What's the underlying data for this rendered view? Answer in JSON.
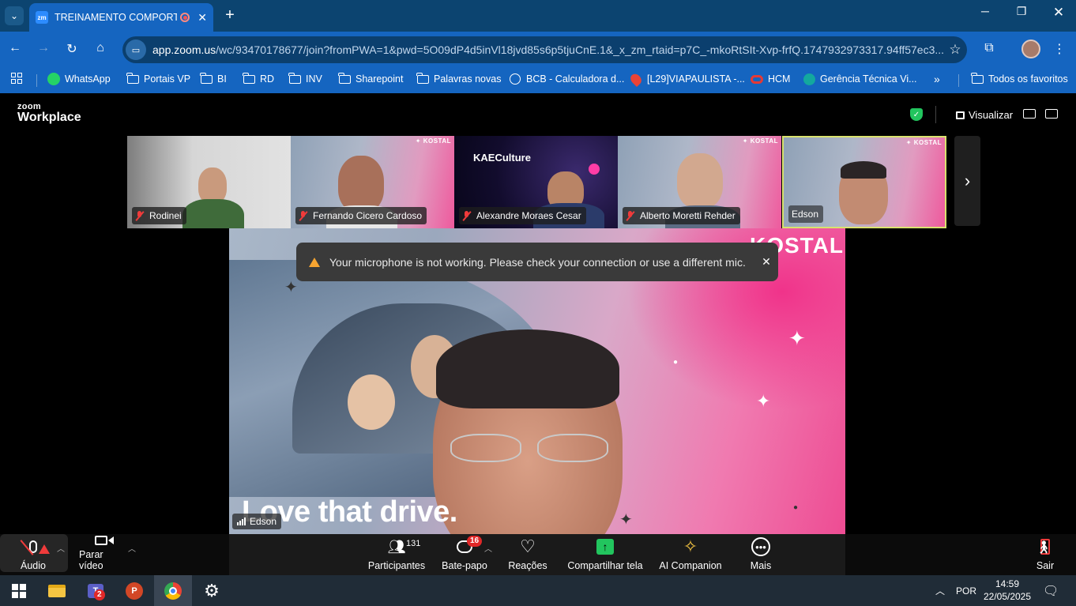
{
  "browser": {
    "tab_title": "TREINAMENTO COMPORTA",
    "tab_favicon": "zm",
    "url_host": "app.zoom.us",
    "url_path": "/wc/93470178677/join?fromPWA=1&pwd=5O09dP4d5inVl18jvd85s6p5tjuCnE.1&_x_zm_rtaid=p7C_-mkoRtSIt-Xvp-frfQ.1747932973317.94ff57ec3...",
    "bookmarks": [
      {
        "label": "WhatsApp",
        "icon": "whatsapp-icon"
      },
      {
        "label": "Portais VP",
        "icon": "folder-icon"
      },
      {
        "label": "BI",
        "icon": "folder-icon"
      },
      {
        "label": "RD",
        "icon": "folder-icon"
      },
      {
        "label": "INV",
        "icon": "folder-icon"
      },
      {
        "label": "Sharepoint",
        "icon": "folder-icon"
      },
      {
        "label": "Palavras novas",
        "icon": "folder-icon"
      },
      {
        "label": "BCB - Calculadora d...",
        "icon": "globe-icon"
      },
      {
        "label": "[L29]VIAPAULISTA -...",
        "icon": "map-pin-icon"
      },
      {
        "label": "HCM",
        "icon": "oracle-icon"
      },
      {
        "label": "Gerência Técnica Vi...",
        "icon": "sharepoint-icon"
      },
      {
        "label": "Todos os favoritos",
        "icon": "folder-icon"
      }
    ]
  },
  "zoom": {
    "logo_top": "zoom",
    "logo_bottom": "Workplace",
    "view_label": "Visualizar",
    "participants_strip": [
      {
        "name": "Rodinei",
        "muted": true
      },
      {
        "name": "Fernando Cicero Cardoso",
        "muted": true
      },
      {
        "name": "Alexandre Moraes Cesar",
        "muted": true
      },
      {
        "name": "Alberto Moretti Rehder",
        "muted": true
      },
      {
        "name": "Edson",
        "muted": false
      }
    ],
    "brand_tag": "✦ KOSTAL",
    "kae_label": "KAECulture",
    "main_speaker": "Edson",
    "main_brand": "KOSTAL",
    "main_slogan": "Love that drive.",
    "toast_message": "Your microphone is not working. Please check your connection or use a different mic.",
    "controls": {
      "audio": "Áudio",
      "video": "Parar vídeo",
      "participants": "Participantes",
      "participants_count": "131",
      "chat": "Bate-papo",
      "chat_badge": "16",
      "reactions": "Reações",
      "share": "Compartilhar tela",
      "ai": "AI Companion",
      "more": "Mais",
      "leave": "Sair"
    }
  },
  "taskbar": {
    "language": "POR",
    "time": "14:59",
    "date": "22/05/2025",
    "teams_badge": "2"
  },
  "colors": {
    "chrome_dark": "#0c4470",
    "chrome": "#1565c0",
    "zoom_green": "#22c55e",
    "muted_red": "#f03b3b",
    "warn_orange": "#f7a531",
    "taskbar": "#202c37"
  }
}
